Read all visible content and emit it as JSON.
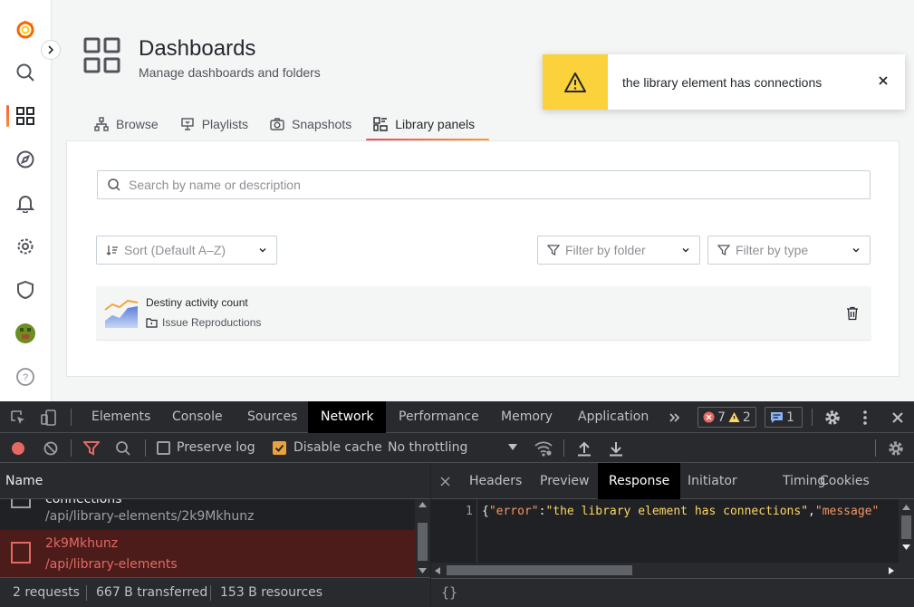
{
  "header": {
    "title": "Dashboards",
    "subtitle": "Manage dashboards and folders"
  },
  "tabs": [
    {
      "label": "Browse",
      "icon": "sitemap-icon"
    },
    {
      "label": "Playlists",
      "icon": "presentation-icon"
    },
    {
      "label": "Snapshots",
      "icon": "camera-icon"
    },
    {
      "label": "Library panels",
      "icon": "library-panel-icon",
      "active": true
    }
  ],
  "search": {
    "placeholder": "Search by name or description"
  },
  "filters": {
    "sort": "Sort (Default A–Z)",
    "folder": "Filter by folder",
    "type": "Filter by type"
  },
  "library_panel": {
    "title": "Destiny activity count",
    "folder": "Issue Reproductions"
  },
  "toast": {
    "message": "the library element has connections",
    "accent": "#fbd13c"
  },
  "devtools": {
    "tabs": [
      "Elements",
      "Console",
      "Sources",
      "Network",
      "Performance",
      "Memory",
      "Application"
    ],
    "active_tab": "Network",
    "errors": "7",
    "warnings": "2",
    "messages": "1",
    "preserve_log": "Preserve log",
    "disable_cache": "Disable cache",
    "throttling": "No throttling",
    "name_header": "Name",
    "requests": [
      {
        "name": "connections",
        "path": "/api/library-elements/2k9Mkhunz"
      },
      {
        "name": "2k9Mkhunz",
        "path": "/api/library-elements",
        "error": true
      }
    ],
    "detail_tabs": [
      "Headers",
      "Preview",
      "Response",
      "Initiator",
      "Timing",
      "Cookies"
    ],
    "active_detail_tab": "Response",
    "response_line": "1",
    "response_key1": "\"error\"",
    "response_val1": "\"the library element has connections\"",
    "response_key2": "\"message\"",
    "status": {
      "requests": "2 requests",
      "transferred": "667 B transferred",
      "resources": "153 B resources"
    },
    "format_button": "{}"
  }
}
